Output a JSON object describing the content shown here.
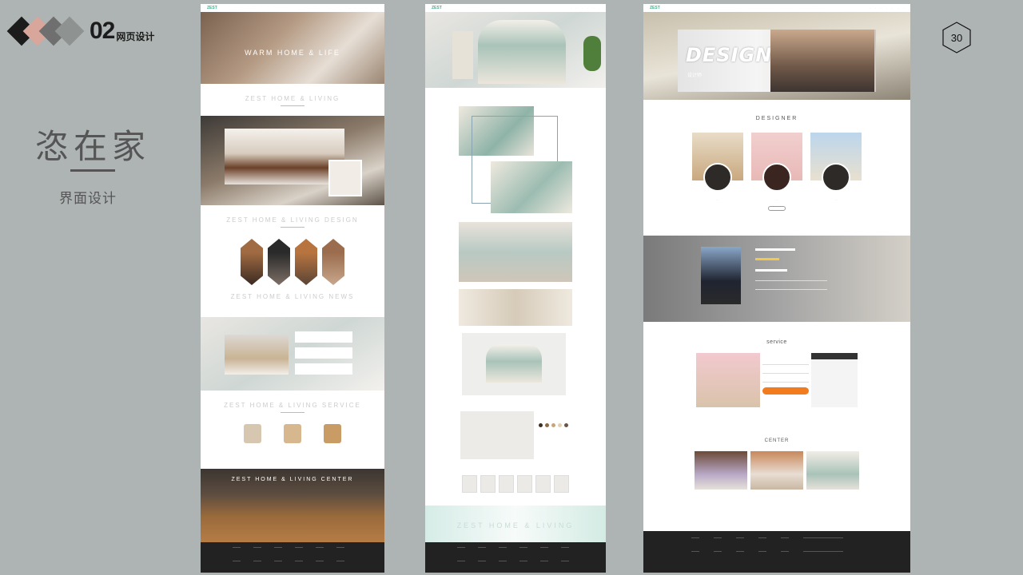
{
  "brand": {
    "number": "02",
    "subtitle": "网页设计",
    "diamond_colors": [
      "#1c1c1c",
      "#d9a69b",
      "#6f6f6f",
      "#8e9392"
    ]
  },
  "heading": {
    "title": "恣在家",
    "subtitle": "界面设计"
  },
  "page_number": "30",
  "mock1": {
    "logo": "ZEST",
    "hero_title": "WARM HOME & LIFE",
    "section_1": "ZEST HOME & LIVING",
    "section_2": "ZEST HOME & LIVING DESIGN",
    "section_3": "ZEST HOME & LIVING NEWS",
    "section_4": "ZEST HOME & LIVING SERVICE",
    "section_5": "ZEST HOME & LIVING CENTER"
  },
  "mock2": {
    "logo": "ZEST",
    "banner_watermark": "ZEST HOME & LIVING"
  },
  "mock3": {
    "logo": "ZEST",
    "banner_title": "DESIGNER",
    "banner_subtitle": "设计师",
    "section_designer": "DESIGNER",
    "section_service": "service",
    "section_center": "CENTER"
  },
  "colors": {
    "background": "#aeb4b3",
    "accent_green": "#41b28a",
    "accent_orange": "#f27b1d"
  }
}
